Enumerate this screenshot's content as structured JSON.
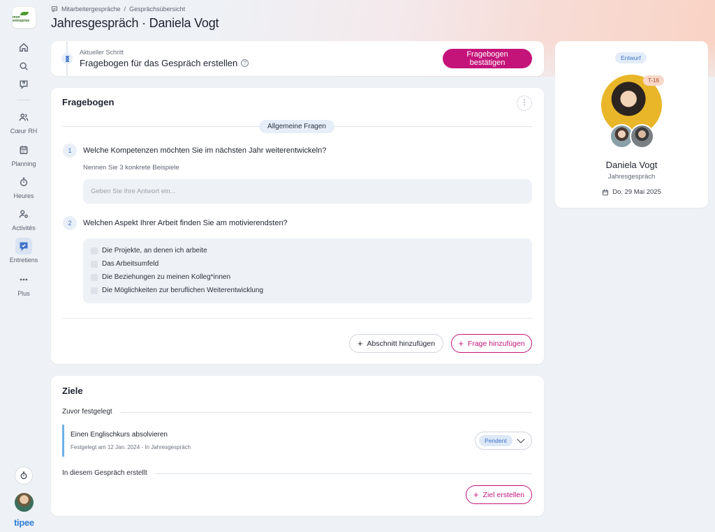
{
  "brand": {
    "logo_text": "mon entreprise",
    "footer_logo": "tipee"
  },
  "sidebar": {
    "items": [
      {
        "icon": "home-icon",
        "label": ""
      },
      {
        "icon": "search-icon",
        "label": ""
      },
      {
        "icon": "help-chat-icon",
        "label": ""
      },
      {
        "icon": "people-icon",
        "label": "Cœur RH"
      },
      {
        "icon": "calendar-icon",
        "label": "Planning"
      },
      {
        "icon": "stopwatch-icon",
        "label": "Heures"
      },
      {
        "icon": "user-gear-icon",
        "label": "Activités"
      },
      {
        "icon": "interview-icon",
        "label": "Entretiens",
        "active": true
      },
      {
        "icon": "dots-icon",
        "label": "Plus"
      }
    ]
  },
  "header": {
    "breadcrumb": [
      "Mitarbeitergespräche",
      "Gesprächsübersicht"
    ],
    "separator": "/",
    "title": "Jahresgespräch · Daniela Vogt"
  },
  "step": {
    "kicker": "Aktueller Schritt",
    "title": "Fragebogen für das Gespräch erstellen",
    "help": "?",
    "confirm_label": "Fragebogen bestätigen"
  },
  "questionnaire": {
    "heading": "Fragebogen",
    "more": "⋮",
    "section": "Allgemeine Fragen",
    "questions": [
      {
        "number": "1",
        "text": "Welche Kompetenzen möchten Sie im nächsten Jahr weiterentwickeln?",
        "hint": "Nennen Sie 3 konkrete Beispiele",
        "placeholder": "Geben Sie Ihre Antwort ein..."
      },
      {
        "number": "2",
        "text": "Welchen Aspekt Ihrer Arbeit finden Sie am motivierendsten?",
        "options": [
          "Die Projekte, an denen ich arbeite",
          "Das Arbeitsumfeld",
          "Die Beziehungen zu meinen Kolleg*innen",
          "Die Möglichkeiten zur beruflichen Weiterentwicklung"
        ]
      }
    ],
    "add_section_label": "Abschnitt hinzufügen",
    "add_question_label": "Frage hinzufügen"
  },
  "goals": {
    "heading": "Ziele",
    "previously_set": "Zuvor festgelegt",
    "items": [
      {
        "title": "Einen Englischkurs absolvieren",
        "meta": "Festgelegt am 12 Jan. 2024 - In Jahresgespräch",
        "status": "Pendent"
      }
    ],
    "created_here": "In diesem Gespräch erstellt",
    "create_label": "Ziel erstellen"
  },
  "profile": {
    "status": "Entwurf",
    "countdown": "T-16",
    "name": "Daniela Vogt",
    "interview_type": "Jahresgespräch",
    "date": "Do. 29 Mai 2025"
  },
  "colors": {
    "accent": "#c4147a",
    "primary_blue": "#3f73c7",
    "goal_bar": "#6fb0e6",
    "background": "#eef1f5"
  }
}
